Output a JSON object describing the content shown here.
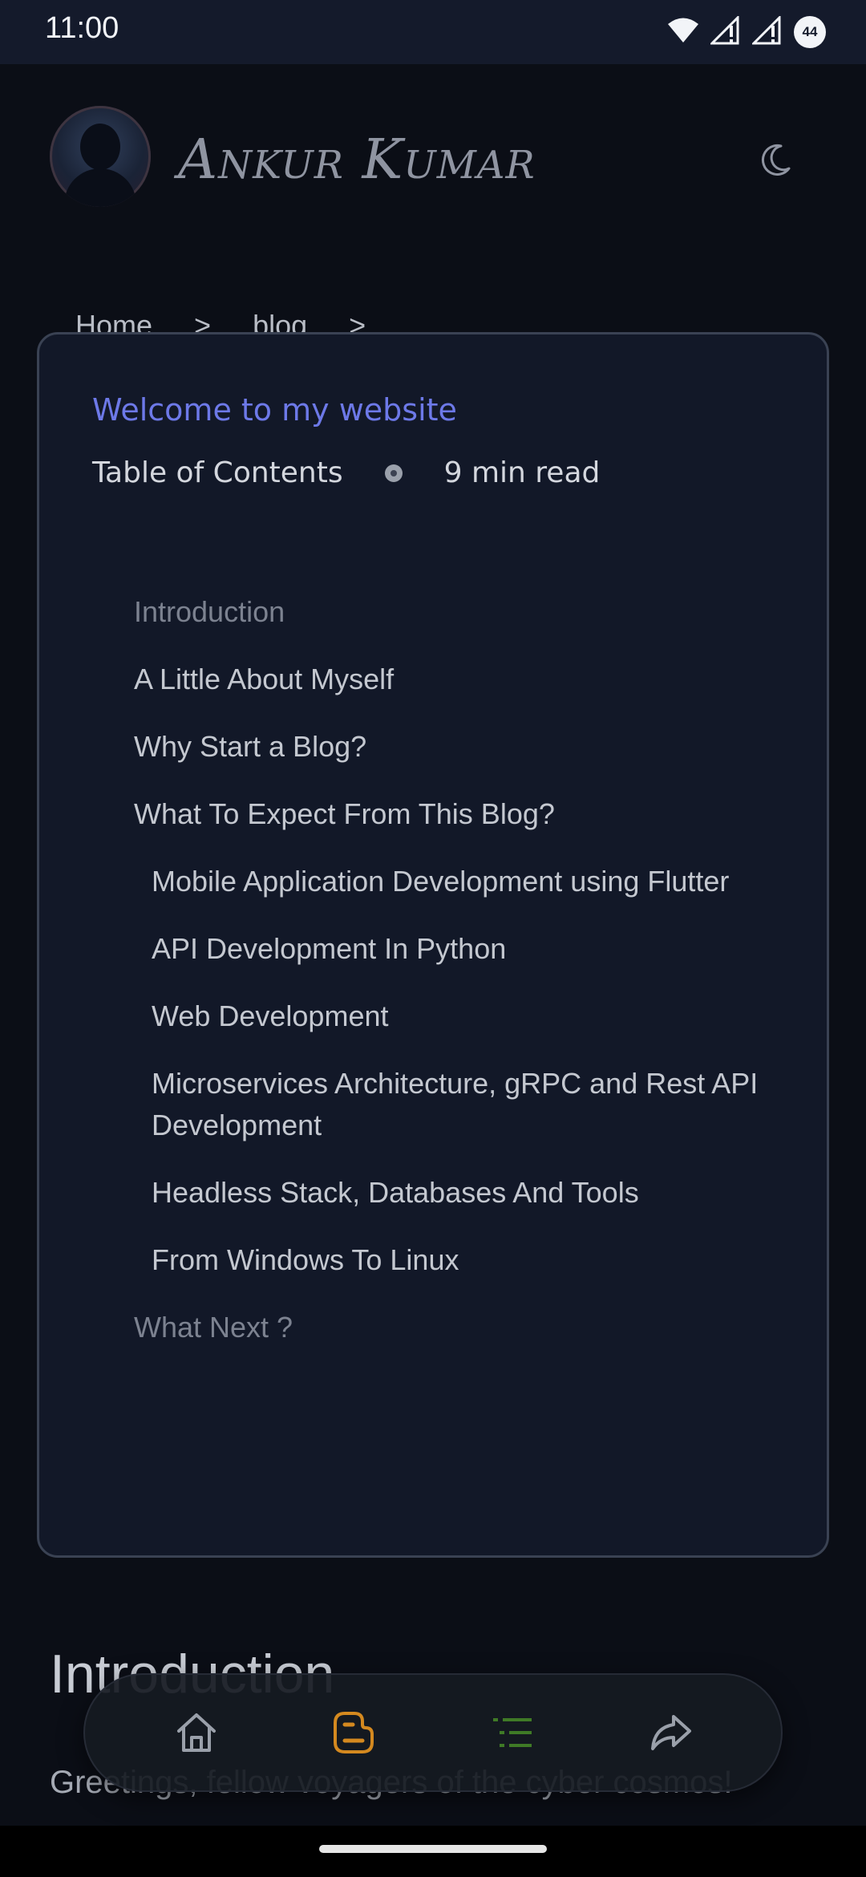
{
  "status_bar": {
    "time": "11:00",
    "battery": "44",
    "icons": [
      "wifi-icon",
      "signal-icon",
      "signal-icon",
      "battery-icon"
    ]
  },
  "header": {
    "site_name": "Ankur Kumar",
    "theme_icon": "moon-icon"
  },
  "breadcrumb": {
    "items": [
      "Home",
      "blog"
    ],
    "separator": ">"
  },
  "toc": {
    "welcome": "Welcome to my website",
    "label": "Table of Contents",
    "read_time": "9 min read",
    "items": [
      {
        "label": "Introduction",
        "level": 1,
        "muted": true
      },
      {
        "label": "A Little About Myself",
        "level": 1,
        "muted": false
      },
      {
        "label": "Why Start a Blog?",
        "level": 1,
        "muted": false
      },
      {
        "label": "What To Expect From This Blog?",
        "level": 1,
        "muted": false
      },
      {
        "label": "Mobile Application Development using Flutter",
        "level": 2,
        "muted": false
      },
      {
        "label": "API Development In Python",
        "level": 2,
        "muted": false
      },
      {
        "label": "Web Development",
        "level": 2,
        "muted": false
      },
      {
        "label": "Microservices Architecture, gRPC and Rest API Development",
        "level": 2,
        "muted": false
      },
      {
        "label": "Headless Stack, Databases And Tools",
        "level": 2,
        "muted": false
      },
      {
        "label": "From Windows To Linux",
        "level": 2,
        "muted": false
      },
      {
        "label": "What Next ?",
        "level": 1,
        "muted": true
      }
    ]
  },
  "article": {
    "heading": "Introduction",
    "text": "Greetings, fellow voyagers of the cyber cosmos!"
  },
  "bottom_nav": {
    "items": [
      {
        "icon": "home-icon",
        "color": "#9aa0aa"
      },
      {
        "icon": "blog-icon",
        "color": "#d4891f"
      },
      {
        "icon": "toc-list-icon",
        "color": "#3f7a26"
      },
      {
        "icon": "share-icon",
        "color": "#9aa0aa"
      }
    ]
  },
  "colors": {
    "background": "#0b0e16",
    "card": "#121828",
    "accent": "#6d79e8",
    "text": "#c4c8d0",
    "muted": "#7c8290"
  }
}
